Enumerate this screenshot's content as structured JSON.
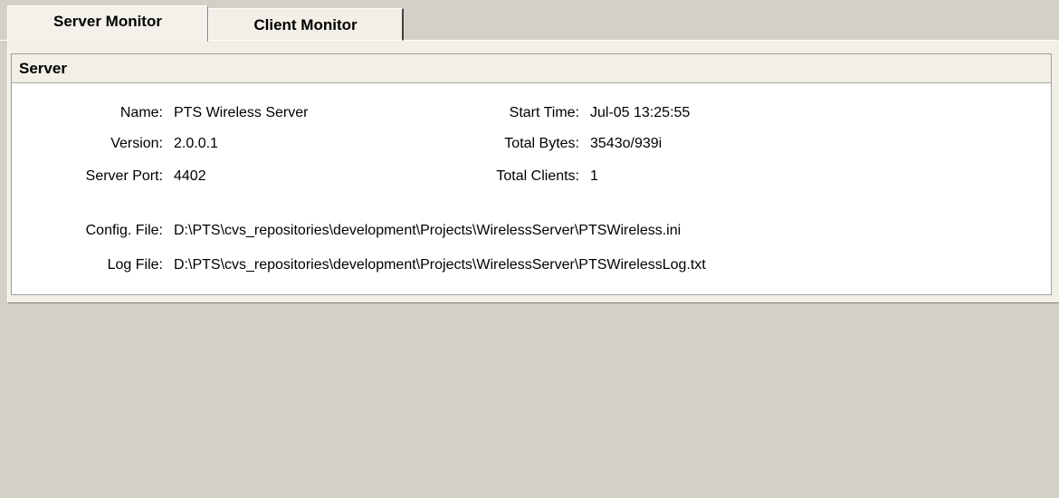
{
  "tabs": [
    {
      "label": "Server Monitor",
      "active": true
    },
    {
      "label": "Client Monitor",
      "active": false
    }
  ],
  "server": {
    "header": "Server",
    "fields": {
      "name": {
        "label": "Name:",
        "value": "PTS Wireless Server"
      },
      "version": {
        "label": "Version:",
        "value": "2.0.0.1"
      },
      "server_port": {
        "label": "Server Port:",
        "value": "4402"
      },
      "start_time": {
        "label": "Start Time:",
        "value": "Jul-05 13:25:55"
      },
      "total_bytes": {
        "label": "Total Bytes:",
        "value": "3543o/939i"
      },
      "total_clients": {
        "label": "Total Clients:",
        "value": "1"
      },
      "config_file": {
        "label": "Config. File:",
        "value": "D:\\PTS\\cvs_repositories\\development\\Projects\\WirelessServer\\PTSWireless.ini"
      },
      "log_file": {
        "label": "Log File:",
        "value": "D:\\PTS\\cvs_repositories\\development\\Projects\\WirelessServer\\PTSWirelessLog.txt"
      }
    }
  },
  "colors": {
    "background": "#d4d0c8",
    "tab_face": "#f1efe6",
    "content": "#ffffff"
  }
}
